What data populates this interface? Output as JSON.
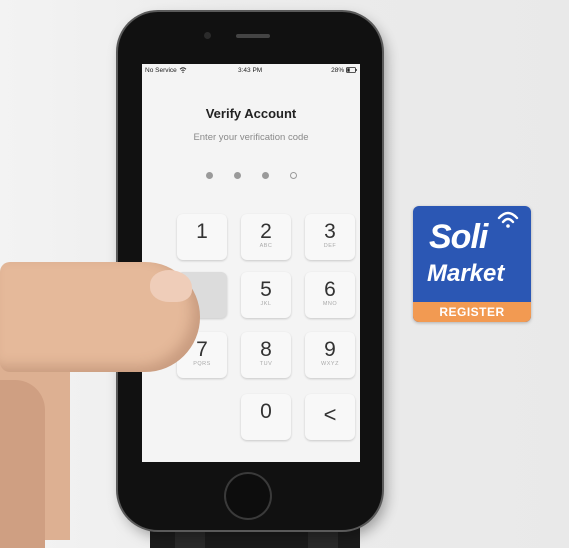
{
  "status_bar": {
    "carrier": "No Service",
    "time": "3:43 PM",
    "battery": "28%"
  },
  "verify": {
    "title": "Verify Account",
    "subtitle": "Enter your verification code",
    "digits_entered": 3,
    "digits_total": 4
  },
  "keypad": {
    "keys": [
      {
        "digit": "1",
        "letters": ""
      },
      {
        "digit": "2",
        "letters": "ABC"
      },
      {
        "digit": "3",
        "letters": "DEF"
      },
      {
        "digit": "",
        "letters": ""
      },
      {
        "digit": "5",
        "letters": "JKL"
      },
      {
        "digit": "6",
        "letters": "MNO"
      },
      {
        "digit": "7",
        "letters": "PQRS"
      },
      {
        "digit": "8",
        "letters": "TUV"
      },
      {
        "digit": "9",
        "letters": "WXYZ"
      },
      {
        "digit": "0",
        "letters": ""
      }
    ],
    "back_glyph": "<"
  },
  "logo": {
    "line1": "Soli",
    "line2": "Market",
    "badge": "REGISTER"
  },
  "colors": {
    "logo_blue": "#2b57b4",
    "logo_orange": "#f29a52"
  }
}
